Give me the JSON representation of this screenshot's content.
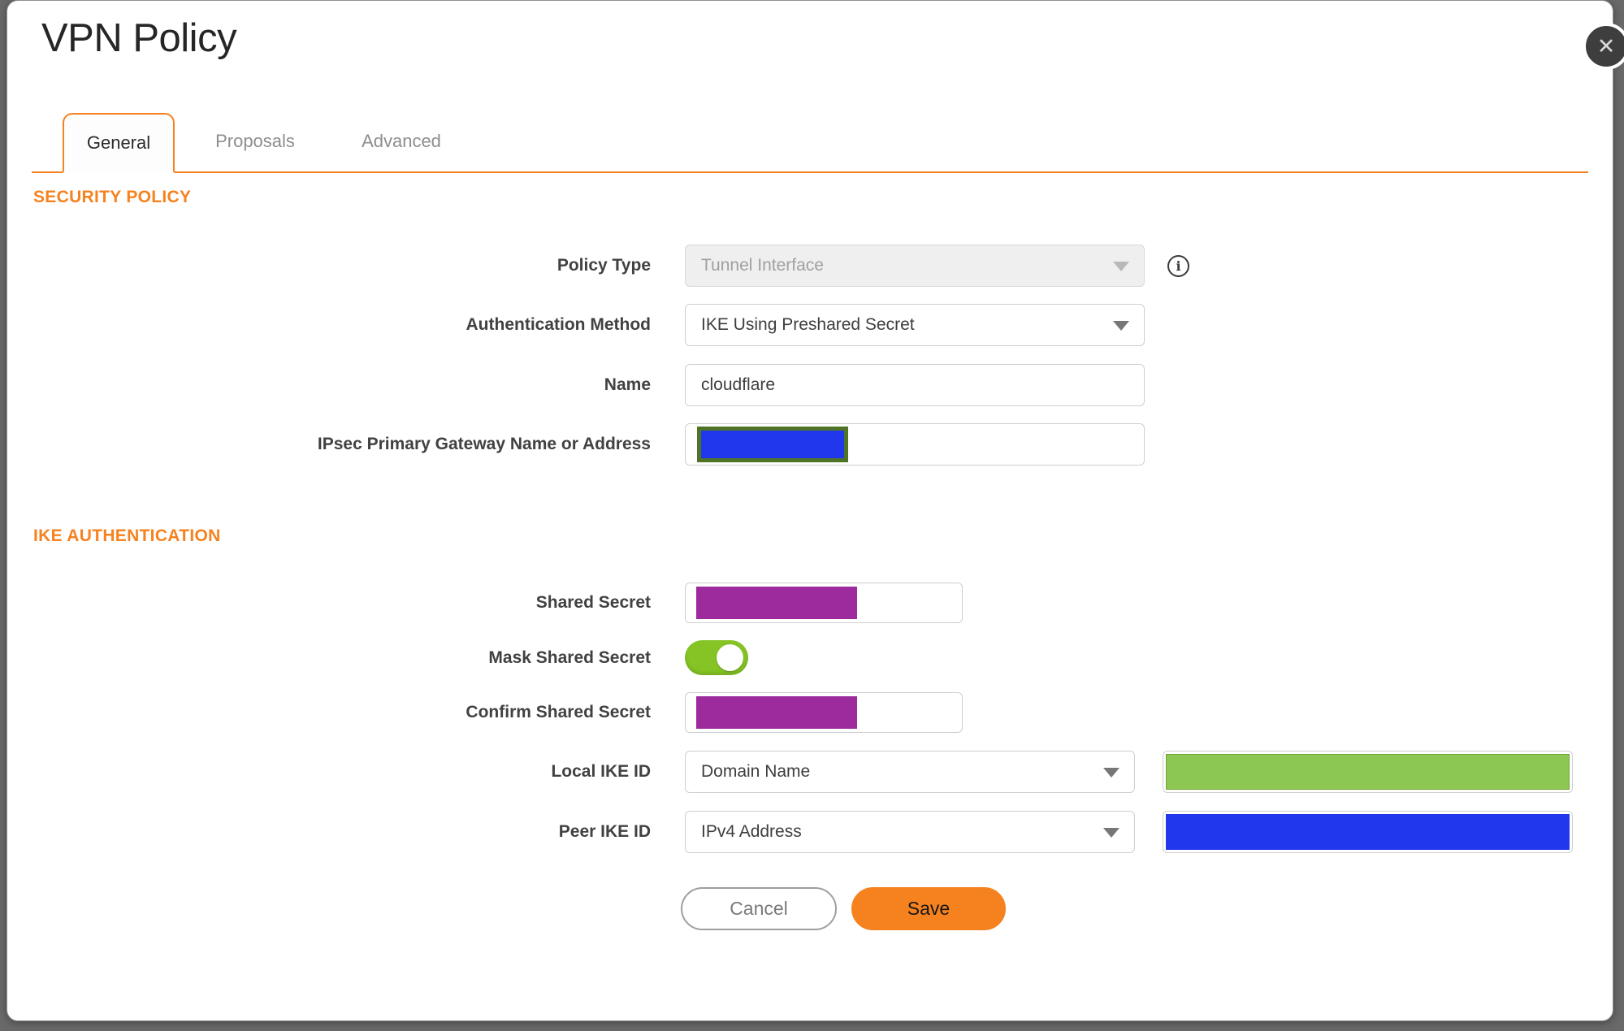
{
  "window": {
    "title": "VPN Policy",
    "close_icon": "✕"
  },
  "tabs": {
    "general": "General",
    "proposals": "Proposals",
    "advanced": "Advanced",
    "active_tab": "General"
  },
  "security_policy": {
    "heading": "SECURITY POLICY",
    "policy_type": {
      "label": "Policy Type",
      "value": "Tunnel Interface",
      "disabled": true,
      "info_icon": "i"
    },
    "authentication_method": {
      "label": "Authentication Method",
      "value": "IKE Using Preshared Secret"
    },
    "name": {
      "label": "Name",
      "value": "cloudflare"
    },
    "gateway": {
      "label": "IPsec Primary Gateway Name or Address",
      "value": "",
      "redacted": true
    }
  },
  "ike_authentication": {
    "heading": "IKE AUTHENTICATION",
    "shared_secret": {
      "label": "Shared Secret",
      "value": "",
      "redacted": true
    },
    "mask_shared_secret": {
      "label": "Mask Shared Secret",
      "state": "on"
    },
    "confirm_shared_secret": {
      "label": "Confirm Shared Secret",
      "value": "",
      "redacted": true
    },
    "local_ike_id": {
      "label": "Local IKE ID",
      "type": "Domain Name",
      "value": "",
      "redacted": true
    },
    "peer_ike_id": {
      "label": "Peer IKE ID",
      "type": "IPv4 Address",
      "value": "",
      "redacted": true
    }
  },
  "footer": {
    "cancel": "Cancel",
    "save": "Save"
  },
  "colors": {
    "accent_orange": "#F6821F",
    "toggle_green": "#85C424",
    "redaction_purple": "#9D2B9D",
    "redaction_blue": "#2137EE",
    "redaction_green_fill": "#8CC653",
    "redaction_olive_border": "#4F7428",
    "backdrop_gray": "#696969",
    "close_button_gray": "#3E3E3E"
  }
}
